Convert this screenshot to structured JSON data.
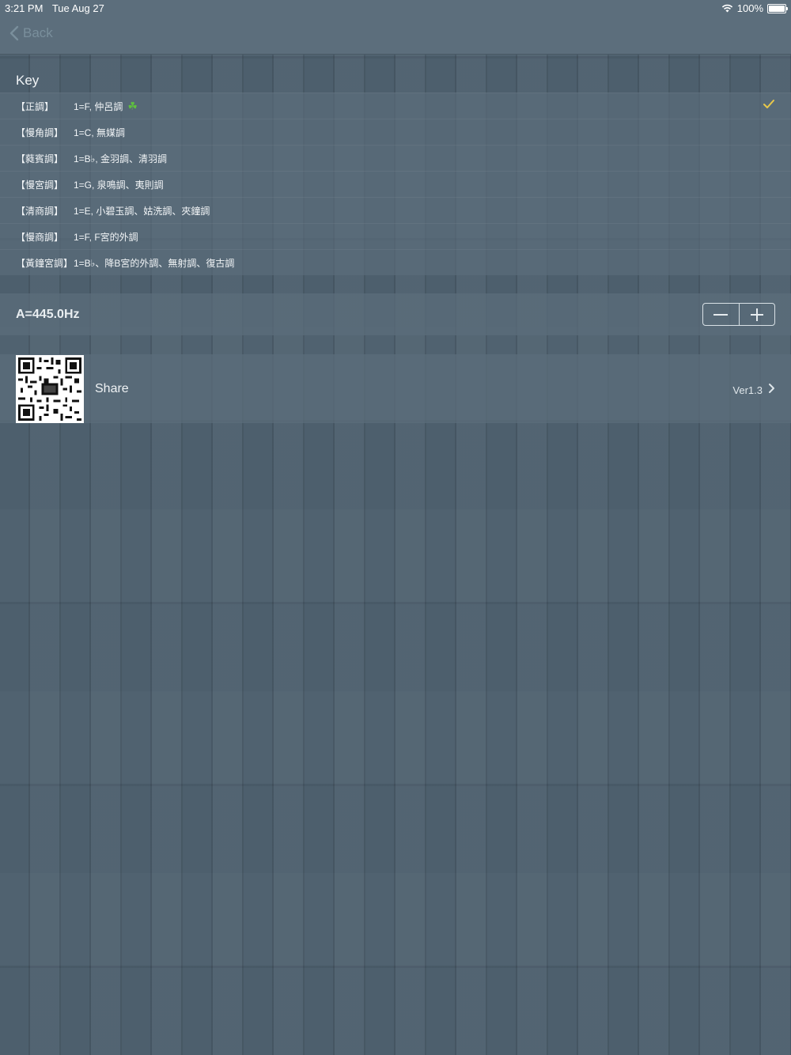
{
  "status_bar": {
    "time": "3:21 PM",
    "date": "Tue Aug 27",
    "battery": "100%"
  },
  "nav": {
    "back_label": "Back"
  },
  "key_section": {
    "header": "Key",
    "items": [
      {
        "name": "【正調】",
        "desc": "1=F, 仲呂調",
        "selected": true,
        "badge_icon": "clover-icon"
      },
      {
        "name": "【慢角調】",
        "desc": "1=C, 無媒調"
      },
      {
        "name": "【蕤賓調】",
        "desc": "1=B♭, 金羽調、清羽調"
      },
      {
        "name": "【慢宮調】",
        "desc": "1=G, 泉鳴調、夷則調"
      },
      {
        "name": "【清商調】",
        "desc": "1=E, 小碧玉調、姑洗調、夾鐘調"
      },
      {
        "name": "【慢商調】",
        "desc": "1=F, F宮的外調"
      },
      {
        "name": "【黃鐘宮調】",
        "desc": "1=B♭、降B宮的外調、無射調、復古調"
      }
    ]
  },
  "frequency": {
    "label": "A=445.0Hz",
    "decrement_icon": "minus-icon",
    "increment_icon": "plus-icon"
  },
  "share": {
    "label": "Share",
    "version": "Ver1.3",
    "qr_icon": "qr-code-icon"
  },
  "colors": {
    "accent_check": "#e8c84a",
    "clover": "#5fbf3f",
    "back_tint": "#7a8f9c"
  }
}
